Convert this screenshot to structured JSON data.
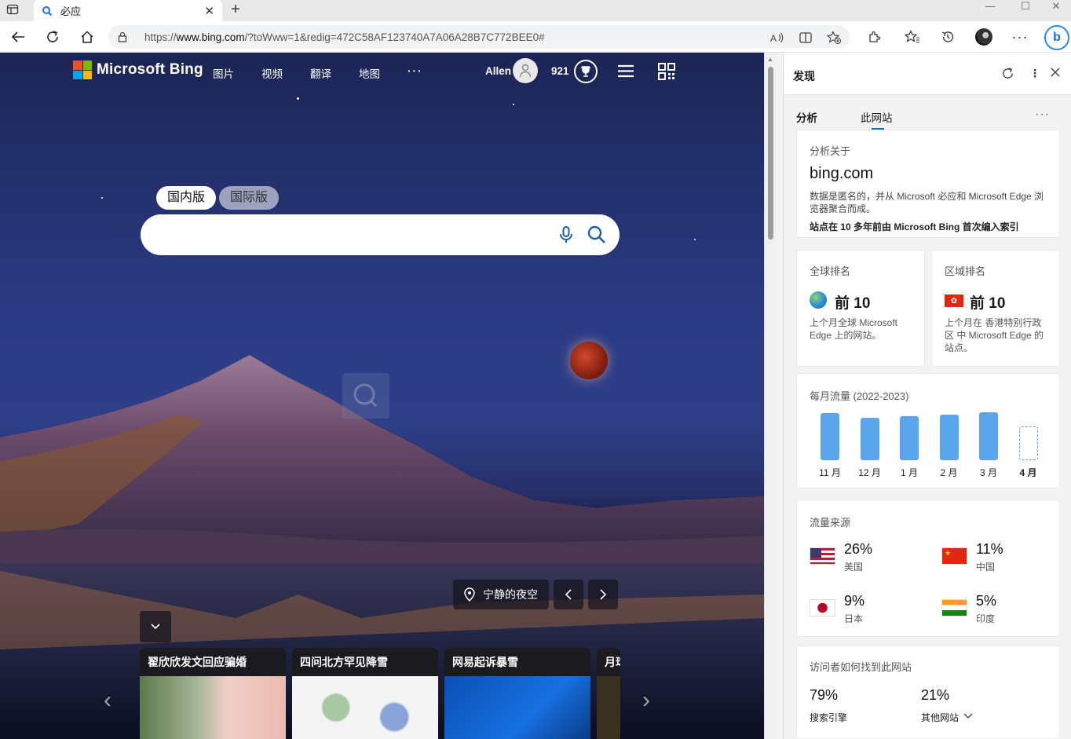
{
  "browser": {
    "tab_title": "必应",
    "tab_favicon": "bing-icon",
    "url_prefix": "https://",
    "url_host": "www.bing.com",
    "url_rest": "/?toWww=1&redig=472C58AF123740A7A06A28B7C772BEE0#"
  },
  "bing": {
    "logo_text": "Microsoft Bing",
    "nav": [
      "图片",
      "视频",
      "翻译",
      "地图",
      "···"
    ],
    "user_name": "Allen",
    "rewards_points": "921",
    "scope_domestic": "国内版",
    "scope_international": "国际版",
    "search_value": "",
    "image_title": "宁静的夜空",
    "cards": [
      {
        "title": "翟欣欣发文回应骗婚"
      },
      {
        "title": "四问北方罕见降雪"
      },
      {
        "title": "网易起诉暴雪"
      },
      {
        "title": "月球"
      }
    ]
  },
  "sidebar": {
    "title": "发现",
    "tabs": [
      "分析",
      "此网站"
    ],
    "about": {
      "label": "分析关于",
      "domain": "bing.com",
      "description": "数据是匿名的，并从 Microsoft 必应和 Microsoft Edge 浏览器聚合而成。",
      "since": "站点在 10 多年前由 Microsoft Bing 首次编入索引"
    },
    "global_rank": {
      "label": "全球排名",
      "value": "前 10",
      "desc": "上个月全球 Microsoft Edge 上的网站。"
    },
    "region_rank": {
      "label": "区域排名",
      "value": "前 10",
      "desc": "上个月在 香港特别行政区 中 Microsoft Edge 的站点。"
    },
    "traffic": {
      "label": "每月流量 (2022-2023)",
      "months": [
        "11 月",
        "12 月",
        "1 月",
        "2 月",
        "3 月",
        "4 月"
      ],
      "relative_values": [
        0.97,
        0.87,
        0.9,
        0.93,
        0.98,
        0.69
      ],
      "current_month_index": 5
    },
    "sources": {
      "label": "流量来源",
      "items": [
        {
          "pct": "26%",
          "country": "美国"
        },
        {
          "pct": "11%",
          "country": "中国"
        },
        {
          "pct": "9%",
          "country": "日本"
        },
        {
          "pct": "5%",
          "country": "印度"
        }
      ]
    },
    "discovery": {
      "label": "访问者如何找到此网站",
      "items": [
        {
          "pct": "79%",
          "name": "搜索引擎"
        },
        {
          "pct": "21%",
          "name": "其他网站"
        }
      ]
    }
  },
  "colors": {
    "accent": "#0f6cbd",
    "bar": "#5aa5ec"
  }
}
